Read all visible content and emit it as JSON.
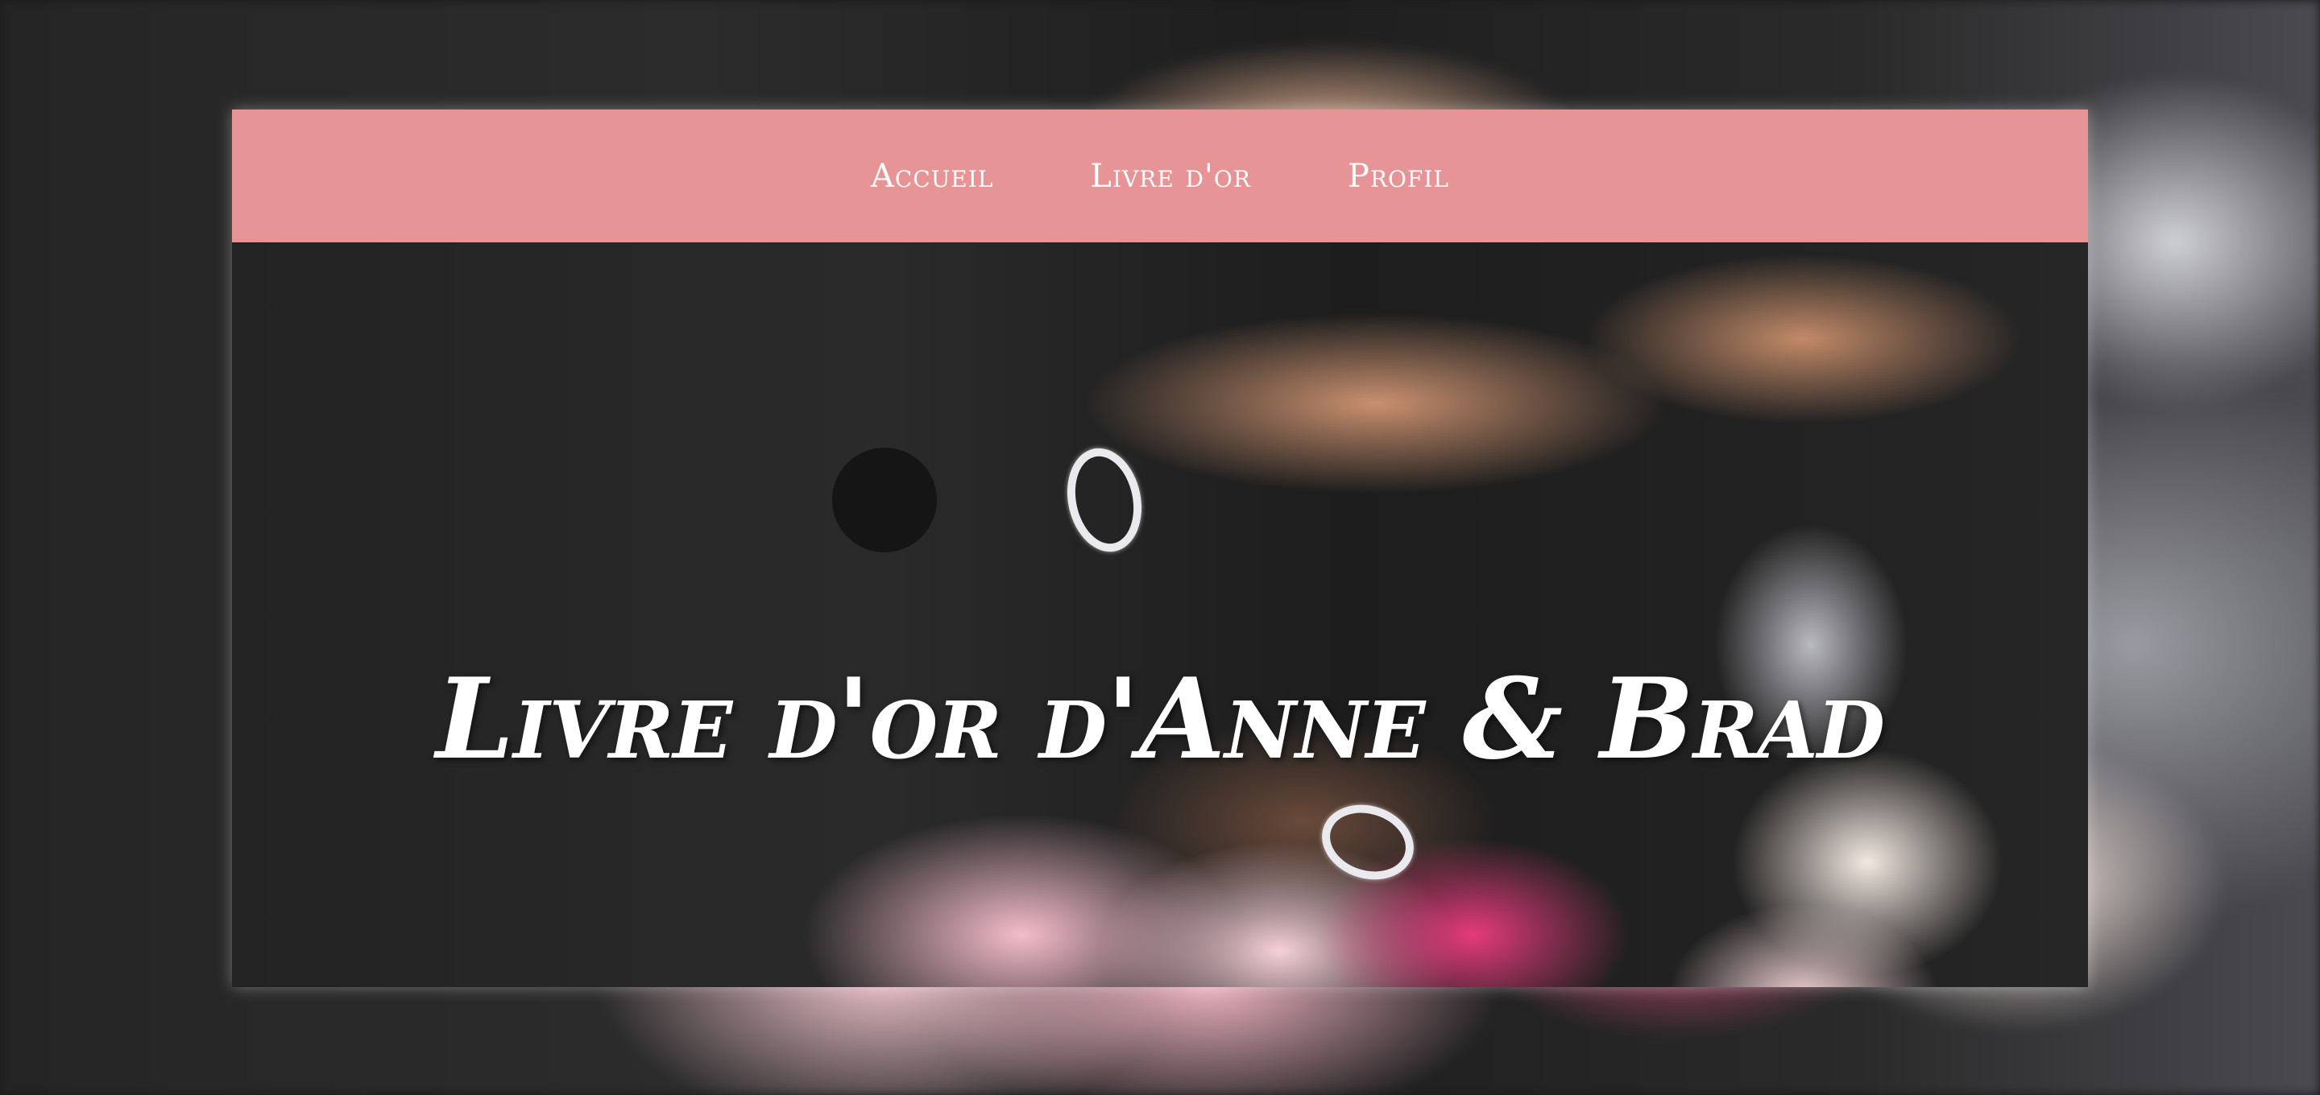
{
  "nav": {
    "items": [
      {
        "label": "Accueil"
      },
      {
        "label": "Livre d'or"
      },
      {
        "label": "Profil"
      }
    ],
    "background_color": "#e79497",
    "text_color": "#ffffff"
  },
  "hero": {
    "title": "Livre d'or d'Anne & Brad",
    "image": "wedding-hands-rings-bouquet-photo"
  }
}
